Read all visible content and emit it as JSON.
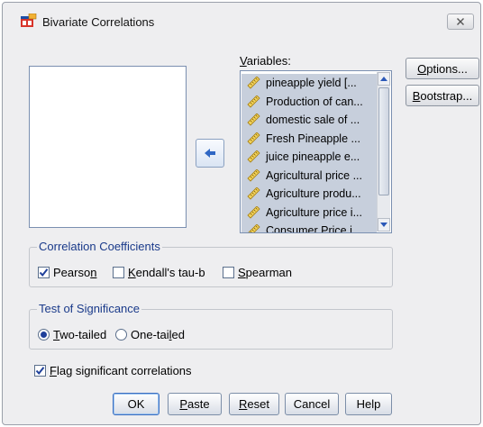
{
  "window": {
    "title": "Bivariate Correlations"
  },
  "variables": {
    "label": "Variables:",
    "items": [
      "pineapple yield  [...",
      "Production of can...",
      "domestic sale of ...",
      "Fresh Pineapple ...",
      "juice pineapple e...",
      "Agricultural price ...",
      "Agriculture produ...",
      "Agriculture price i...",
      "Consumer Price i..."
    ]
  },
  "side_buttons": {
    "options": "Options...",
    "bootstrap": "Bootstrap..."
  },
  "correlation": {
    "legend": "Correlation Coefficients",
    "pearson": {
      "label": "Pearson",
      "checked": true
    },
    "kendall": {
      "label": "Kendall's tau-b",
      "checked": false
    },
    "spearman": {
      "label": "Spearman",
      "checked": false
    }
  },
  "significance": {
    "legend": "Test of Significance",
    "two_tailed": {
      "label": "Two-tailed",
      "selected": true
    },
    "one_tailed": {
      "label": "One-tailed",
      "selected": false
    }
  },
  "flag": {
    "label": "Flag significant correlations",
    "checked": true
  },
  "buttons": {
    "ok": "OK",
    "paste": "Paste",
    "reset": "Reset",
    "cancel": "Cancel",
    "help": "Help"
  },
  "colors": {
    "dialog_bg": "#eeeef0",
    "selection": "#c7cfdc",
    "legend_text": "#1a3a8a"
  },
  "icons": {
    "app": "bivariate-correlations-icon",
    "variable": "scale-ruler-icon",
    "move": "arrow-left-icon",
    "close": "close-icon"
  }
}
